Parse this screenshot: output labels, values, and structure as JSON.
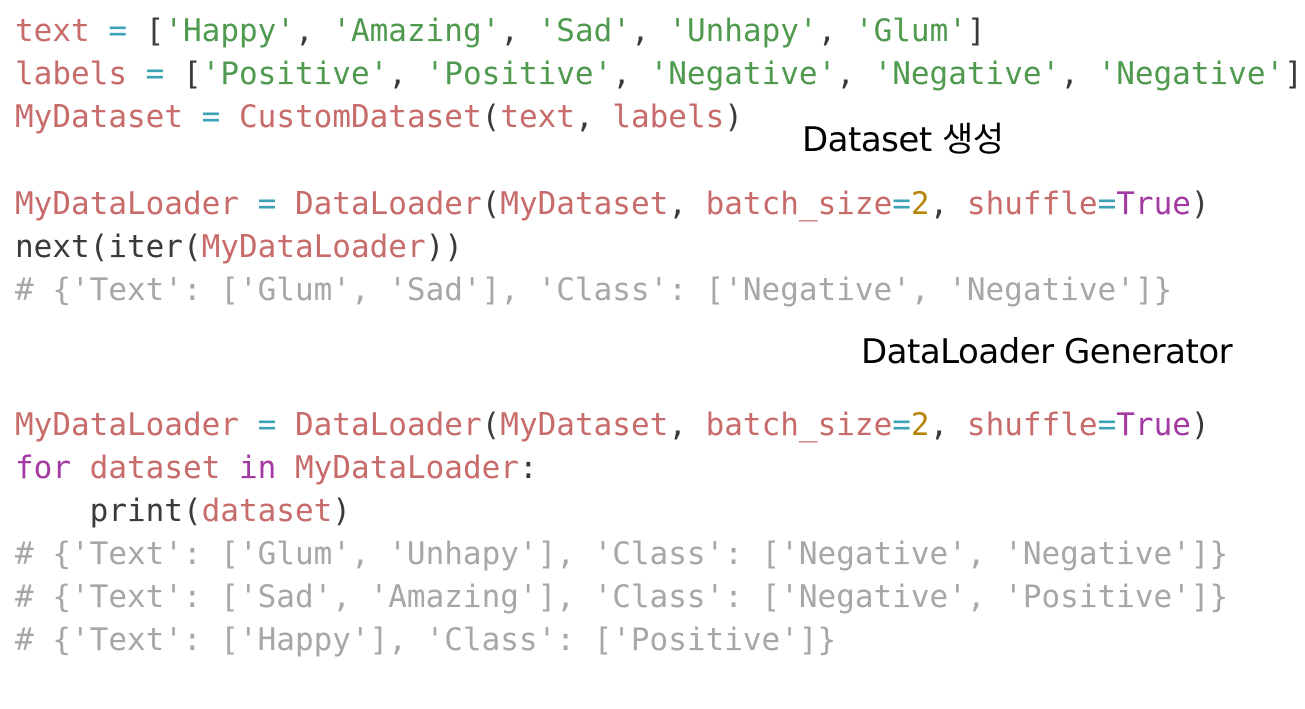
{
  "colors": {
    "background": "#ffffff",
    "variable": "#c86b6b",
    "string": "#4f9a4f",
    "operator": "#3ba3b5",
    "number": "#b7860b",
    "keyword": "#a33aa3",
    "plain": "#3a3a3a",
    "comment": "#a7a7a7",
    "caption": "#000000"
  },
  "captions": {
    "dataset": "Dataset 생성",
    "generator": "DataLoader Generator"
  },
  "blocks": [
    [
      [
        [
          "t-var",
          "text"
        ],
        [
          "t-plain",
          " "
        ],
        [
          "t-op",
          "="
        ],
        [
          "t-plain",
          " ["
        ],
        [
          "t-str",
          "'Happy'"
        ],
        [
          "t-plain",
          ", "
        ],
        [
          "t-str",
          "'Amazing'"
        ],
        [
          "t-plain",
          ", "
        ],
        [
          "t-str",
          "'Sad'"
        ],
        [
          "t-plain",
          ", "
        ],
        [
          "t-str",
          "'Unhapy'"
        ],
        [
          "t-plain",
          ", "
        ],
        [
          "t-str",
          "'Glum'"
        ],
        [
          "t-plain",
          "]"
        ]
      ],
      [
        [
          "t-var",
          "labels"
        ],
        [
          "t-plain",
          " "
        ],
        [
          "t-op",
          "="
        ],
        [
          "t-plain",
          " ["
        ],
        [
          "t-str",
          "'Positive'"
        ],
        [
          "t-plain",
          ", "
        ],
        [
          "t-str",
          "'Positive'"
        ],
        [
          "t-plain",
          ", "
        ],
        [
          "t-str",
          "'Negative'"
        ],
        [
          "t-plain",
          ", "
        ],
        [
          "t-str",
          "'Negative'"
        ],
        [
          "t-plain",
          ", "
        ],
        [
          "t-str",
          "'Negative'"
        ],
        [
          "t-plain",
          "]"
        ]
      ],
      [
        [
          "t-var",
          "MyDataset"
        ],
        [
          "t-plain",
          " "
        ],
        [
          "t-op",
          "="
        ],
        [
          "t-plain",
          " "
        ],
        [
          "t-var",
          "CustomDataset"
        ],
        [
          "t-plain",
          "("
        ],
        [
          "t-var",
          "text"
        ],
        [
          "t-plain",
          ", "
        ],
        [
          "t-var",
          "labels"
        ],
        [
          "t-plain",
          ")"
        ]
      ]
    ],
    [
      [
        [
          "t-var",
          "MyDataLoader"
        ],
        [
          "t-plain",
          " "
        ],
        [
          "t-op",
          "="
        ],
        [
          "t-plain",
          " "
        ],
        [
          "t-var",
          "DataLoader"
        ],
        [
          "t-plain",
          "("
        ],
        [
          "t-var",
          "MyDataset"
        ],
        [
          "t-plain",
          ", "
        ],
        [
          "t-var",
          "batch_size"
        ],
        [
          "t-op",
          "="
        ],
        [
          "t-num",
          "2"
        ],
        [
          "t-plain",
          ", "
        ],
        [
          "t-var",
          "shuffle"
        ],
        [
          "t-op",
          "="
        ],
        [
          "t-kw",
          "True"
        ],
        [
          "t-plain",
          ")"
        ]
      ],
      [
        [
          "t-plain",
          "next(iter("
        ],
        [
          "t-var",
          "MyDataLoader"
        ],
        [
          "t-plain",
          "))"
        ]
      ],
      [
        [
          "t-cmt",
          "# {'Text': ['Glum', 'Sad'], 'Class': ['Negative', 'Negative']}"
        ]
      ]
    ],
    [
      [
        [
          "t-var",
          "MyDataLoader"
        ],
        [
          "t-plain",
          " "
        ],
        [
          "t-op",
          "="
        ],
        [
          "t-plain",
          " "
        ],
        [
          "t-var",
          "DataLoader"
        ],
        [
          "t-plain",
          "("
        ],
        [
          "t-var",
          "MyDataset"
        ],
        [
          "t-plain",
          ", "
        ],
        [
          "t-var",
          "batch_size"
        ],
        [
          "t-op",
          "="
        ],
        [
          "t-num",
          "2"
        ],
        [
          "t-plain",
          ", "
        ],
        [
          "t-var",
          "shuffle"
        ],
        [
          "t-op",
          "="
        ],
        [
          "t-kw",
          "True"
        ],
        [
          "t-plain",
          ")"
        ]
      ],
      [
        [
          "t-kw",
          "for"
        ],
        [
          "t-plain",
          " "
        ],
        [
          "t-var",
          "dataset"
        ],
        [
          "t-plain",
          " "
        ],
        [
          "t-kw",
          "in"
        ],
        [
          "t-plain",
          " "
        ],
        [
          "t-var",
          "MyDataLoader"
        ],
        [
          "t-plain",
          ":"
        ]
      ],
      [
        [
          "t-plain",
          "    print("
        ],
        [
          "t-var",
          "dataset"
        ],
        [
          "t-plain",
          ")"
        ]
      ],
      [
        [
          "t-cmt",
          "# {'Text': ['Glum', 'Unhapy'], 'Class': ['Negative', 'Negative']}"
        ]
      ],
      [
        [
          "t-cmt",
          "# {'Text': ['Sad', 'Amazing'], 'Class': ['Negative', 'Positive']}"
        ]
      ],
      [
        [
          "t-cmt",
          "# {'Text': ['Happy'], 'Class': ['Positive']}"
        ]
      ]
    ]
  ]
}
